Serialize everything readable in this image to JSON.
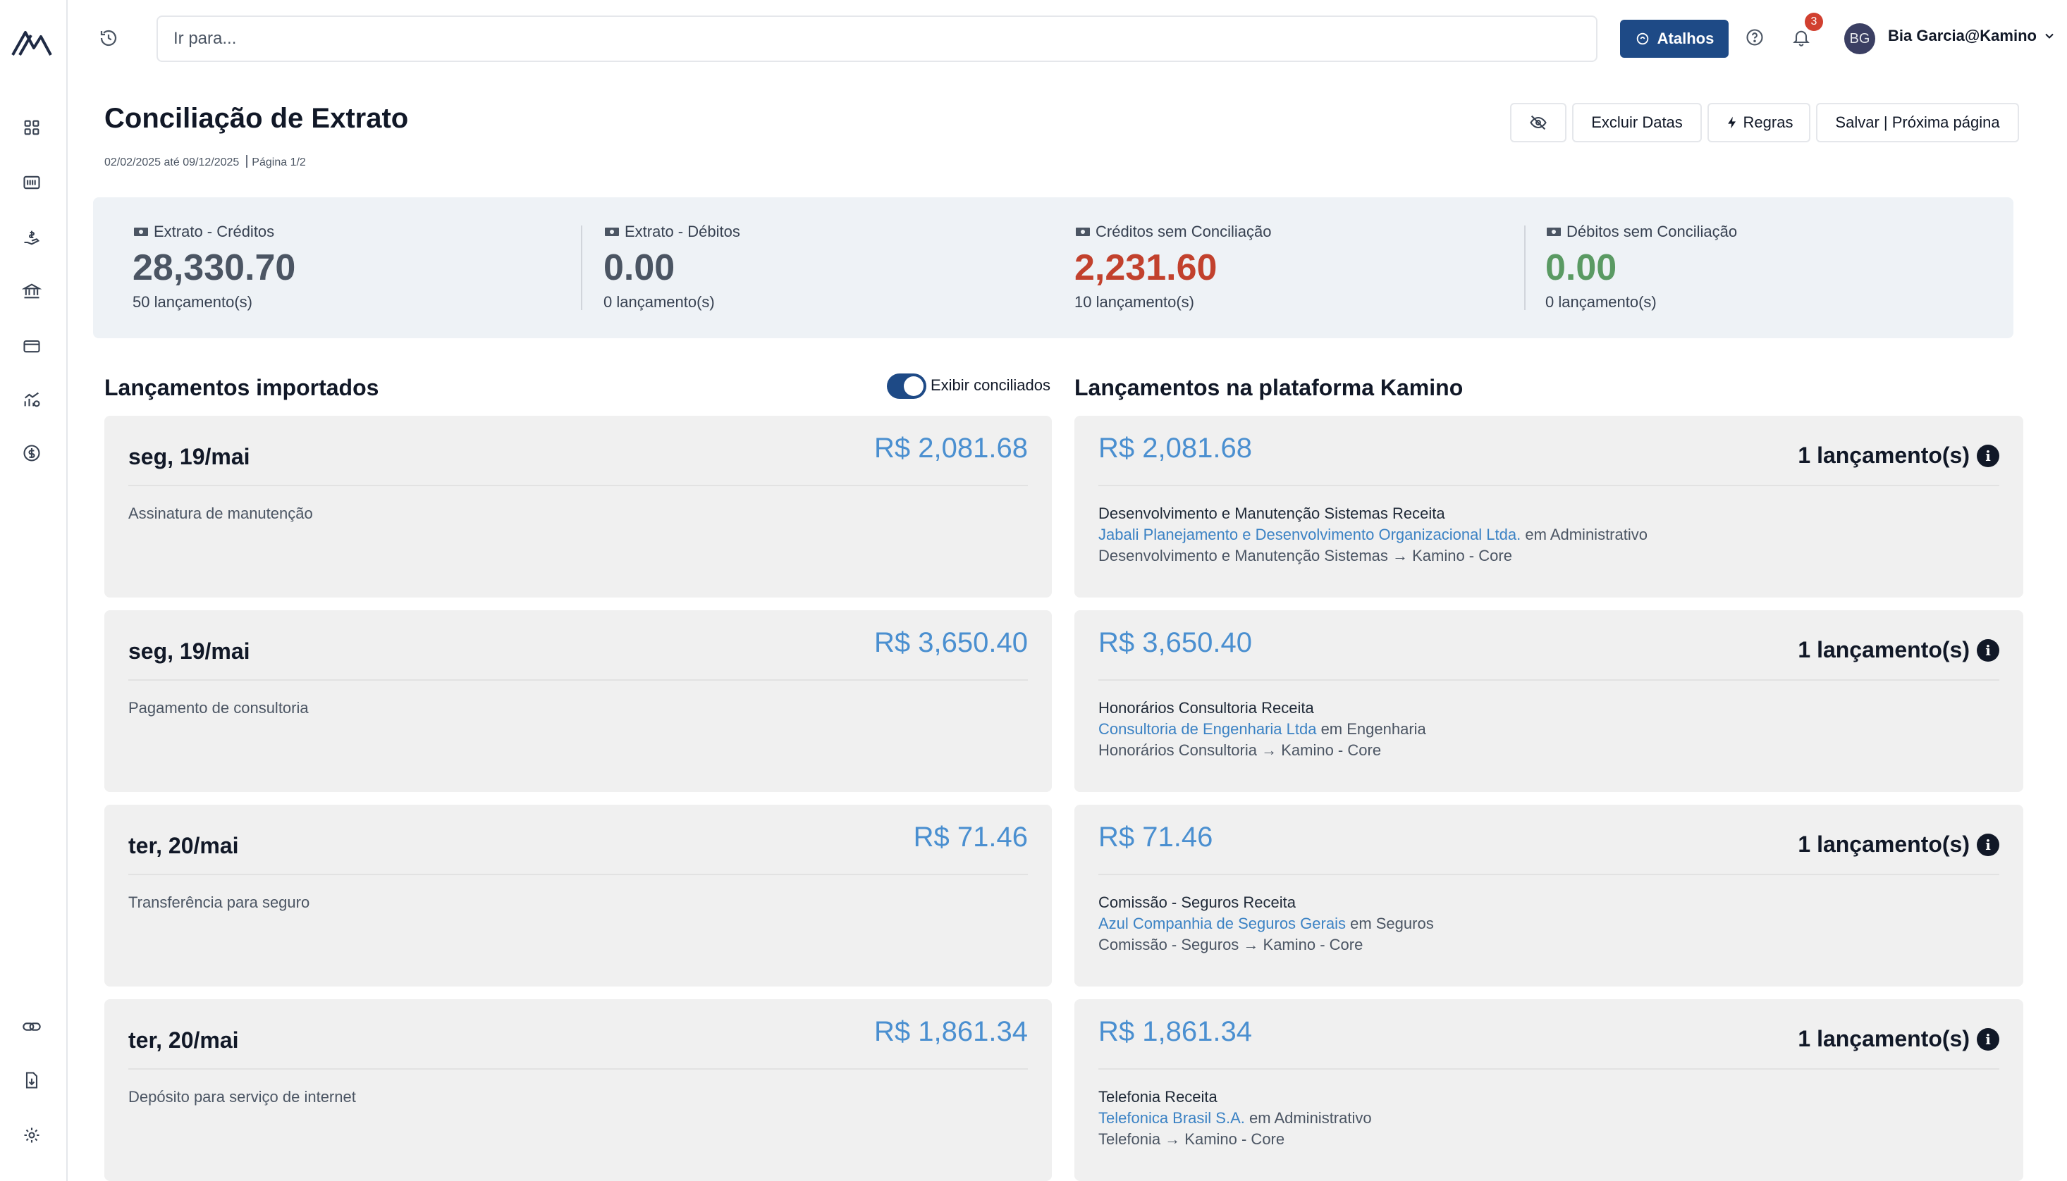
{
  "topbar": {
    "search_placeholder": "Ir para...",
    "shortcuts_label": "Atalhos",
    "notification_count": "3",
    "avatar_initials": "BG",
    "user_name": "Bia Garcia@Kamino"
  },
  "header": {
    "title": "Conciliação de Extrato",
    "date_range": "02/02/2025 até 09/12/2025",
    "page": "Página 1/2",
    "buttons": {
      "exclude_dates": "Excluir Datas",
      "rules": "Regras",
      "save_next": "Salvar | Próxima página"
    }
  },
  "summary": [
    {
      "label": "Extrato - Créditos",
      "value": "28,330.70",
      "count": "50 lançamento(s)",
      "color": "#4b5563"
    },
    {
      "label": "Extrato - Débitos",
      "value": "0.00",
      "count": "0 lançamento(s)",
      "color": "#4b5563"
    },
    {
      "label": "Créditos sem Conciliação",
      "value": "2,231.60",
      "count": "10 lançamento(s)",
      "color": "#c2412d"
    },
    {
      "label": "Débitos sem Conciliação",
      "value": "0.00",
      "count": "0 lançamento(s)",
      "color": "#5a9a63"
    }
  ],
  "imported": {
    "title": "Lançamentos importados",
    "toggle_label": "Exibir conciliados",
    "toggle_on": true,
    "items": [
      {
        "date": "seg, 19/mai",
        "amount": "R$ 2,081.68",
        "description": "Assinatura de manutenção"
      },
      {
        "date": "seg, 19/mai",
        "amount": "R$ 3,650.40",
        "description": "Pagamento de consultoria"
      },
      {
        "date": "ter, 20/mai",
        "amount": "R$ 71.46",
        "description": "Transferência para seguro"
      },
      {
        "date": "ter, 20/mai",
        "amount": "R$ 1,861.34",
        "description": "Depósito para serviço de internet"
      }
    ]
  },
  "platform": {
    "title": "Lançamentos na plataforma Kamino",
    "items": [
      {
        "amount": "R$ 2,081.68",
        "count": "1 lançamento(s)",
        "category": "Desenvolvimento e Manutenção Sistemas Receita",
        "company": "Jabali Planejamento e Desenvolvimento Organizacional Ltda.",
        "department": " em Administrativo",
        "route": "Desenvolvimento e Manutenção Sistemas → Kamino - Core"
      },
      {
        "amount": "R$ 3,650.40",
        "count": "1 lançamento(s)",
        "category": "Honorários Consultoria Receita",
        "company": "Consultoria de Engenharia Ltda",
        "department": " em Engenharia",
        "route": "Honorários Consultoria → Kamino - Core"
      },
      {
        "amount": "R$ 71.46",
        "count": "1 lançamento(s)",
        "category": "Comissão - Seguros Receita",
        "company": "Azul Companhia de Seguros Gerais",
        "department": " em Seguros",
        "route": "Comissão - Seguros → Kamino - Core"
      },
      {
        "amount": "R$ 1,861.34",
        "count": "1 lançamento(s)",
        "category": "Telefonia Receita",
        "company": "Telefonica Brasil S.A.",
        "department": " em Administrativo",
        "route": "Telefonia → Kamino - Core"
      }
    ]
  },
  "sidebar": {
    "icons": [
      "dashboard-icon",
      "barcode-icon",
      "hand-money-icon",
      "bank-icon",
      "credit-card-icon",
      "chart-icon",
      "dollar-coin-icon",
      "link-icon",
      "file-download-icon",
      "gear-icon"
    ]
  },
  "colors": {
    "accent": "#1e4a86",
    "amount_blue": "#4a8fd0",
    "link_blue": "#3b82c4",
    "negative_red": "#c2412d",
    "positive_green": "#5a9a63"
  }
}
